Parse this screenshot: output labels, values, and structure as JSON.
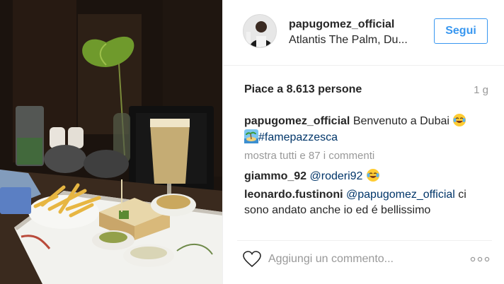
{
  "header": {
    "username": "papugomez_official",
    "location": "Atlantis The Palm, Du...",
    "follow_label": "Segui"
  },
  "post": {
    "likes": "Piace a 8.613 persone",
    "time": "1 g"
  },
  "caption": {
    "user": "papugomez_official",
    "text": "Benvenuto a Dubai",
    "hashtag": "#famepazzesca",
    "emoji_icons": [
      "tears-of-joy-emoji",
      "desert-island-emoji"
    ]
  },
  "view_all_comments": "mostra tutti e 87 i commenti",
  "comments": [
    {
      "user": "giammo_92",
      "mention": "@roderi92",
      "text": ""
    },
    {
      "user": "leonardo.fustinoni",
      "mention": "@papugomez_official",
      "text": "ci sono andato anche io ed é bellissimo"
    }
  ],
  "add_comment": {
    "placeholder": "Aggiungi un commento..."
  },
  "colors": {
    "accent": "#3897f0",
    "link": "#003569",
    "muted": "#999999",
    "border": "#efefef"
  },
  "icons": [
    "heart-icon",
    "more-options-icon"
  ]
}
